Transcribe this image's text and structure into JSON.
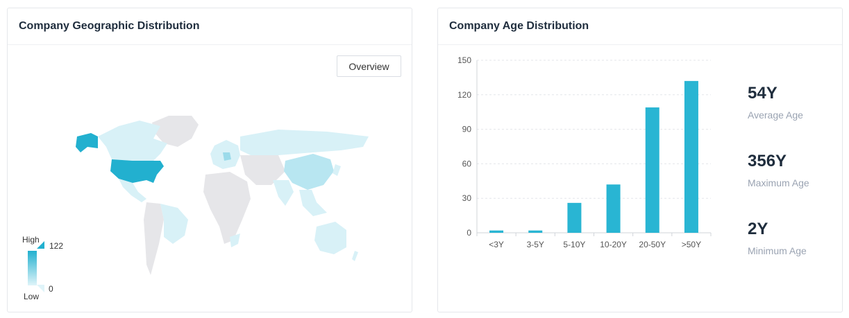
{
  "geo_card": {
    "title": "Company Geographic Distribution",
    "overview_label": "Overview",
    "legend": {
      "high_label": "High",
      "low_label": "Low",
      "max": "122",
      "min": "0"
    },
    "colors": {
      "high": "#22b0cf",
      "low": "#dff4f9",
      "empty": "#e6e6e9"
    }
  },
  "age_card": {
    "title": "Company Age Distribution",
    "stats": [
      {
        "value": "54Y",
        "label": "Average Age"
      },
      {
        "value": "356Y",
        "label": "Maximum Age"
      },
      {
        "value": "2Y",
        "label": "Minimum Age"
      }
    ]
  },
  "chart_data": {
    "type": "bar",
    "categories": [
      "<3Y",
      "3-5Y",
      "5-10Y",
      "10-20Y",
      "20-50Y",
      ">50Y"
    ],
    "values": [
      2,
      2,
      26,
      42,
      109,
      132
    ],
    "yticks": [
      0,
      30,
      60,
      90,
      120,
      150
    ],
    "ylim": [
      0,
      150
    ],
    "grid": true,
    "color": "#29b5d3"
  }
}
